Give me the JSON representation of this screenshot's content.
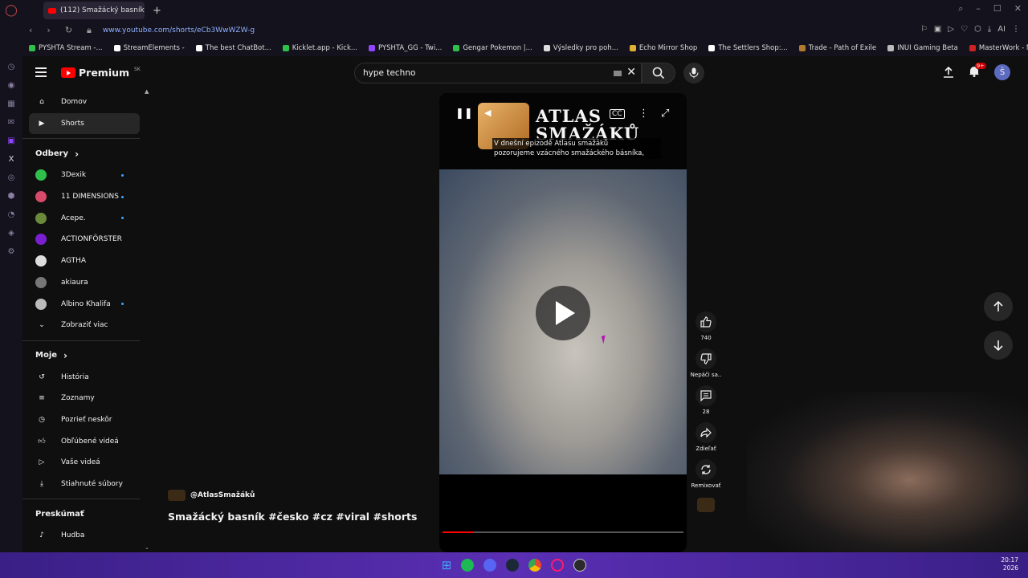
{
  "browser": {
    "tab_title": "(112) Smažácký basník",
    "url": "www.youtube.com/shorts/eCb3WwWZW-g",
    "bookmarks": [
      "PYSHTA Stream -...",
      "StreamElements -",
      "The best ChatBot...",
      "Kicklet.app - Kick...",
      "PYSHTA_GG - Twi...",
      "Gengar Pokemon |...",
      "Výsledky pro poh...",
      "Echo Mirror Shop",
      "The Settlers Shop:...",
      "Trade - Path of Exile",
      "INUI Gaming Beta",
      "MasterWork - MW..."
    ],
    "ai_label": "AI"
  },
  "masthead": {
    "logo_text": "Premium",
    "logo_region": "SK",
    "search_value": "hype techno",
    "notif_badge": "9+",
    "avatar_letter": "Š"
  },
  "guide": {
    "main": [
      {
        "label": "Domov",
        "icon": "home-icon"
      },
      {
        "label": "Shorts",
        "icon": "shorts-icon",
        "active": true
      }
    ],
    "subs_header": "Odbery",
    "subs": [
      {
        "label": "3Dexik",
        "color": "#2fbf4a",
        "dot": true
      },
      {
        "label": "11 DIMENSIONS",
        "color": "#d84a6a",
        "dot": true
      },
      {
        "label": "Acepe.",
        "color": "#6a8a3a",
        "dot": true
      },
      {
        "label": "ACTIONFÖRSTER",
        "color": "#7a1fd0",
        "dot": false
      },
      {
        "label": "AGTHA",
        "color": "#dddddd",
        "dot": false
      },
      {
        "label": "akiaura",
        "color": "#777777",
        "dot": false
      },
      {
        "label": "Albino Khalifa",
        "color": "#bbbbbb",
        "dot": true
      }
    ],
    "show_more": "Zobraziť viac",
    "you_header": "Moje",
    "you": [
      {
        "label": "História",
        "icon": "history-icon"
      },
      {
        "label": "Zoznamy",
        "icon": "playlists-icon"
      },
      {
        "label": "Pozrieť neskôr",
        "icon": "watch-later-icon"
      },
      {
        "label": "Obľúbené videá",
        "icon": "liked-icon"
      },
      {
        "label": "Vaše videá",
        "icon": "your-videos-icon"
      },
      {
        "label": "Stiahnuté súbory",
        "icon": "downloads-icon"
      }
    ],
    "explore_header": "Preskúmať",
    "explore": [
      {
        "label": "Hudba",
        "icon": "music-icon"
      }
    ]
  },
  "short": {
    "banner_title_line1": "ATLAS",
    "banner_title_line2": "SMAŽÁKŮ",
    "caption_line1": "V dnešní epizodě Atlasu smažáků",
    "caption_line2": "pozorujeme vzácného smažáckého básníka,",
    "progress": 0.13,
    "channel": "@AtlasSmažáků",
    "title": "Smažácký basník #česko #cz #viral #shorts"
  },
  "actions": {
    "like_count": "740",
    "dislike_label": "Nepáči sa..",
    "comment_count": "28",
    "share_label": "Zdieľať",
    "remix_label": "Remixovať"
  },
  "clock": {
    "time": "20:17",
    "year": "2026"
  }
}
